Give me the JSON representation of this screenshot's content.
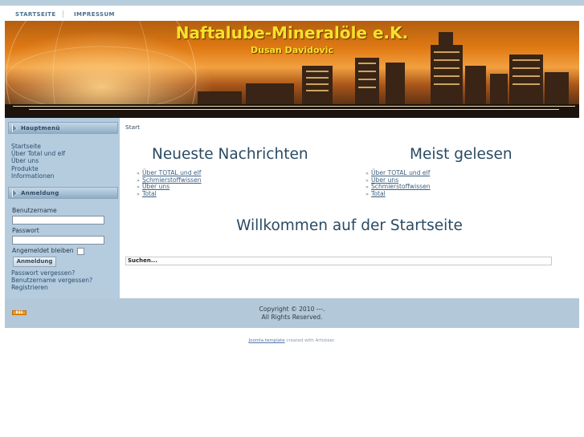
{
  "topnav": {
    "home": "STARTSEITE",
    "impressum": "IMPRESSUM"
  },
  "header": {
    "title": "Naftalube-Mineralöle e.K.",
    "subtitle": "Dusan Davidovic"
  },
  "sidebar": {
    "main_menu_title": "Hauptmenü",
    "menu": [
      "Startseite",
      "Über Total und elf",
      "Über uns",
      "Produkte",
      "Informationen"
    ],
    "login_title": "Anmeldung",
    "login": {
      "username_label": "Benutzername",
      "password_label": "Passwort",
      "remember_label": "Angemeldet bleiben",
      "button_label": "Anmeldung",
      "links": [
        "Passwort vergessen?",
        "Benutzername vergessen?",
        "Registrieren"
      ]
    }
  },
  "content": {
    "breadcrumb": "Start",
    "news": {
      "title": "Neueste Nachrichten",
      "items": [
        "Über TOTAL und elf",
        "Schmierstoffwissen",
        "Über uns",
        "Total"
      ]
    },
    "popular": {
      "title": "Meist gelesen",
      "items": [
        "Über TOTAL und elf",
        "Über uns",
        "Schmierstoffwissen",
        "Total"
      ]
    },
    "welcome": "Willkommen auf der Startseite",
    "search_value": "Suchen..."
  },
  "footer": {
    "line1": "Copyright © 2010 ---.",
    "line2": "All Rights Reserved.",
    "rss_icon": "rss-icon",
    "rss_text": "RSS"
  },
  "credit": {
    "link": "Joomla template",
    "text": " created with Artisteer."
  },
  "colors": {
    "header_title": "#f7e12a",
    "sidebar_bg": "#b5ccdf",
    "footer_bg": "#b3c8d8",
    "heading": "#2a4a63"
  }
}
